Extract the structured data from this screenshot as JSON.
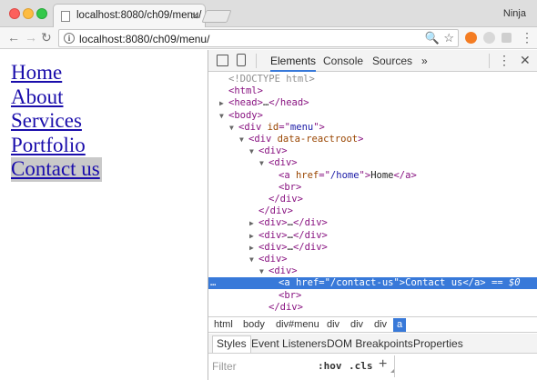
{
  "browser": {
    "tab_title": "localhost:8080/ch09/menu/",
    "tab_close": "×",
    "profile": "Ninja",
    "url": "localhost:8080/ch09/menu/",
    "back": "←",
    "forward": "→",
    "reload": "↻",
    "zoom_glyph": "🔍",
    "star_glyph": "☆",
    "menu_glyph": "⋮",
    "info_glyph": "i"
  },
  "page": {
    "menu": [
      {
        "label": "Home",
        "active": false
      },
      {
        "label": "About",
        "active": false
      },
      {
        "label": "Services",
        "active": false
      },
      {
        "label": "Portfolio",
        "active": false
      },
      {
        "label": "Contact us",
        "active": true
      }
    ]
  },
  "devtools": {
    "tabs": [
      "Elements",
      "Console",
      "Sources"
    ],
    "more": "»",
    "kebab": "⋮",
    "close": "✕",
    "tree": [
      {
        "indent": 0,
        "tri": "",
        "parts": [
          [
            "comment",
            "<!DOCTYPE html>"
          ]
        ]
      },
      {
        "indent": 0,
        "tri": "",
        "parts": [
          [
            "tag",
            "<html>"
          ]
        ]
      },
      {
        "indent": 0,
        "tri": "▶",
        "parts": [
          [
            "tag",
            "<head>"
          ],
          [
            "text",
            "…"
          ],
          [
            "tag",
            "</head>"
          ]
        ]
      },
      {
        "indent": 0,
        "tri": "▼",
        "parts": [
          [
            "tag",
            "<body>"
          ]
        ]
      },
      {
        "indent": 1,
        "tri": "▼",
        "parts": [
          [
            "tag",
            "<div "
          ],
          [
            "attr",
            "id"
          ],
          [
            "tag",
            "=\""
          ],
          [
            "val",
            "menu"
          ],
          [
            "tag",
            "\">"
          ]
        ]
      },
      {
        "indent": 2,
        "tri": "▼",
        "parts": [
          [
            "tag",
            "<div "
          ],
          [
            "attr",
            "data-reactroot"
          ],
          [
            "tag",
            ">"
          ]
        ]
      },
      {
        "indent": 3,
        "tri": "▼",
        "parts": [
          [
            "tag",
            "<div>"
          ]
        ]
      },
      {
        "indent": 4,
        "tri": "▼",
        "parts": [
          [
            "tag",
            "<div>"
          ]
        ]
      },
      {
        "indent": 5,
        "tri": "",
        "parts": [
          [
            "tag",
            "<a "
          ],
          [
            "attr",
            "href"
          ],
          [
            "tag",
            "=\""
          ],
          [
            "val",
            "/home"
          ],
          [
            "tag",
            "\">"
          ],
          [
            "text",
            "Home"
          ],
          [
            "tag",
            "</a>"
          ]
        ]
      },
      {
        "indent": 5,
        "tri": "",
        "parts": [
          [
            "tag",
            "<br>"
          ]
        ]
      },
      {
        "indent": 4,
        "tri": "",
        "parts": [
          [
            "tag",
            "</div>"
          ]
        ]
      },
      {
        "indent": 3,
        "tri": "",
        "parts": [
          [
            "tag",
            "</div>"
          ]
        ]
      },
      {
        "indent": 3,
        "tri": "▶",
        "parts": [
          [
            "tag",
            "<div>"
          ],
          [
            "text",
            "…"
          ],
          [
            "tag",
            "</div>"
          ]
        ]
      },
      {
        "indent": 3,
        "tri": "▶",
        "parts": [
          [
            "tag",
            "<div>"
          ],
          [
            "text",
            "…"
          ],
          [
            "tag",
            "</div>"
          ]
        ]
      },
      {
        "indent": 3,
        "tri": "▶",
        "parts": [
          [
            "tag",
            "<div>"
          ],
          [
            "text",
            "…"
          ],
          [
            "tag",
            "</div>"
          ]
        ]
      },
      {
        "indent": 3,
        "tri": "▼",
        "parts": [
          [
            "tag",
            "<div>"
          ]
        ]
      },
      {
        "indent": 4,
        "tri": "▼",
        "parts": [
          [
            "tag",
            "<div>"
          ]
        ]
      },
      {
        "indent": 5,
        "tri": "",
        "selected": true,
        "parts": [
          [
            "tag",
            "<a "
          ],
          [
            "attr",
            "href"
          ],
          [
            "tag",
            "=\""
          ],
          [
            "val",
            "/contact-us"
          ],
          [
            "tag",
            "\">"
          ],
          [
            "text",
            "Contact us"
          ],
          [
            "tag",
            "</a>"
          ],
          [
            "text",
            " == "
          ],
          [
            "eq",
            "$0"
          ]
        ]
      },
      {
        "indent": 5,
        "tri": "",
        "parts": [
          [
            "tag",
            "<br>"
          ]
        ]
      },
      {
        "indent": 4,
        "tri": "",
        "parts": [
          [
            "tag",
            "</div>"
          ]
        ]
      }
    ],
    "selected_marker": "…",
    "breadcrumbs": [
      "html",
      "body",
      "div#menu",
      "div",
      "div",
      "div",
      "a"
    ],
    "sub_tabs": [
      "Styles",
      "Event Listeners",
      "DOM Breakpoints",
      "Properties"
    ],
    "filter_placeholder": "Filter",
    "hov": ":hov",
    "cls": ".cls",
    "plus": "+"
  }
}
